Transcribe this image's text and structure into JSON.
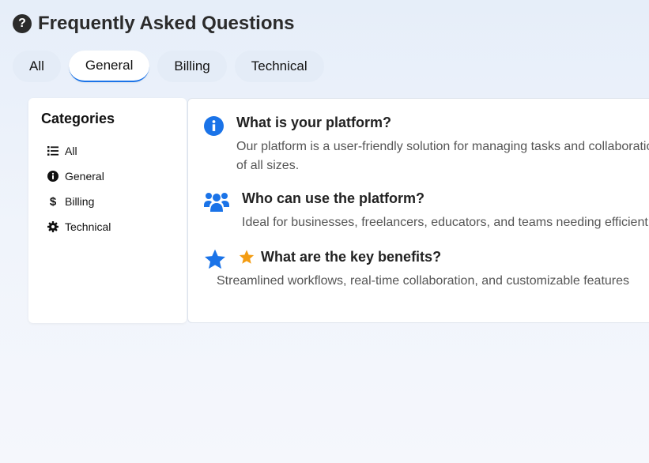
{
  "header": {
    "icon": "question-circle-icon",
    "title": "Frequently Asked Questions"
  },
  "tabs": [
    {
      "label": "All",
      "active": false
    },
    {
      "label": "General",
      "active": true
    },
    {
      "label": "Billing",
      "active": false
    },
    {
      "label": "Technical",
      "active": false
    }
  ],
  "sidebar": {
    "title": "Categories",
    "items": [
      {
        "label": "All",
        "icon": "list-icon"
      },
      {
        "label": "General",
        "icon": "info-circle-icon"
      },
      {
        "label": "Billing",
        "icon": "dollar-icon"
      },
      {
        "label": "Technical",
        "icon": "gear-icon"
      }
    ]
  },
  "faqs": [
    {
      "icon": "info-circle-icon",
      "question": "What is your platform?",
      "answer_line1": "Our platform is a user-friendly solution for managing tasks and collaboration",
      "answer_line2": "of all sizes."
    },
    {
      "icon": "users-icon",
      "question": "Who can use the platform?",
      "answer_line1": "Ideal for businesses, freelancers, educators, and teams needing efficient"
    },
    {
      "icon": "star-icon",
      "question_icon": "star-icon",
      "question": "What are the key benefits?",
      "answer_line1": "Streamlined workflows, real-time collaboration, and customizable features"
    }
  ],
  "colors": {
    "accent": "#1a73e8",
    "star_orange": "#f39c12",
    "title": "#2b2b2b"
  }
}
